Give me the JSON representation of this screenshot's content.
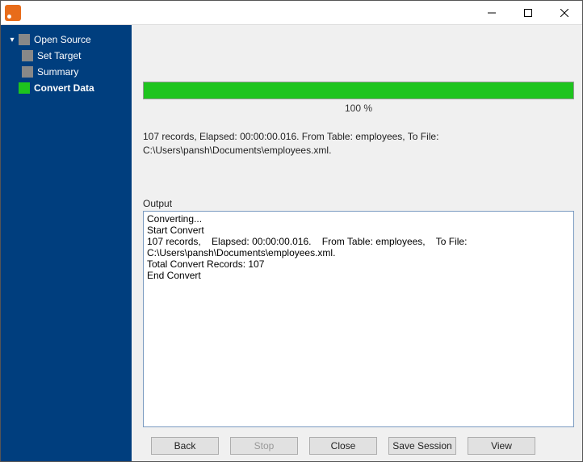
{
  "sidebar": {
    "items": [
      {
        "label": "Open Source",
        "active": false
      },
      {
        "label": "Set Target",
        "active": false
      },
      {
        "label": "Summary",
        "active": false
      },
      {
        "label": "Convert Data",
        "active": true
      }
    ]
  },
  "progress": {
    "percent_label": "100 %",
    "fill_percent": 100
  },
  "status_text": "107 records,    Elapsed: 00:00:00.016.    From Table: employees,    To File: C:\\Users\\pansh\\Documents\\employees.xml.",
  "output": {
    "label": "Output",
    "content": "Converting...\nStart Convert\n107 records,    Elapsed: 00:00:00.016.    From Table: employees,    To File: C:\\Users\\pansh\\Documents\\employees.xml.\nTotal Convert Records: 107\nEnd Convert\n"
  },
  "buttons": {
    "back": "Back",
    "stop": "Stop",
    "close": "Close",
    "save_session": "Save Session",
    "view": "View"
  }
}
